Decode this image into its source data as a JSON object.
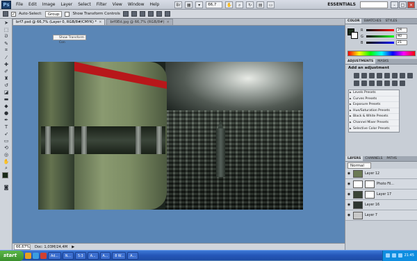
{
  "menubar": {
    "logo": "Ps",
    "items": [
      "File",
      "Edit",
      "Image",
      "Layer",
      "Select",
      "Filter",
      "View",
      "Window",
      "Help"
    ],
    "zoom": "66,7",
    "workspace": "ESSENTIALS",
    "window_buttons": [
      "-",
      "□",
      "×"
    ]
  },
  "options": {
    "auto_select_label": "Auto-Select:",
    "auto_select_value": "Group",
    "transform_label": "Show Transform Controls"
  },
  "tabs": [
    {
      "label": "brf7.psd @ 66,7% (Layer 0, RGB/8#/CMYK) *",
      "active": true
    },
    {
      "label": "brf0Ed.jpg @ 66,7% (RGB/8#)",
      "active": false
    }
  ],
  "canvas": {
    "tooltip": "Show Transform Con"
  },
  "status": {
    "zoom": "66,67%",
    "doc": "Doc: 1,03M/24,4M"
  },
  "color_panel": {
    "tabs": [
      "COLOR",
      "SWATCHES",
      "STYLES"
    ],
    "sliders": [
      {
        "letter": "R",
        "value": "24",
        "track": "#c02020"
      },
      {
        "letter": "G",
        "value": "40",
        "track": "#20a020"
      },
      {
        "letter": "B",
        "value": "21",
        "track": "#2040c0"
      }
    ]
  },
  "adjustments_panel": {
    "tabs": [
      "ADJUSTMENTS",
      "MASKS"
    ],
    "title": "Add an adjustment",
    "presets": [
      "Levels Presets",
      "Curves Presets",
      "Exposure Presets",
      "Hue/Saturation Presets",
      "Black & White Presets",
      "Channel Mixer Presets",
      "Selective Color Presets"
    ]
  },
  "layers_panel": {
    "tabs": [
      "LAYERS",
      "CHANNELS",
      "PATHS"
    ],
    "blend_mode": "Normal",
    "layers": [
      {
        "name": "Layer 12",
        "thumb": "#6b7a55",
        "mask": false,
        "selected": false
      },
      {
        "name": "Photo Fil...",
        "thumb": "#ffffff",
        "mask": true,
        "selected": false
      },
      {
        "name": "Layer 17",
        "thumb": "#3a4436",
        "mask": true,
        "selected": false
      },
      {
        "name": "Layer 16",
        "thumb": "#2d3530",
        "mask": false,
        "selected": false
      },
      {
        "name": "Layer 7",
        "thumb": "#c8c8c8",
        "mask": false,
        "selected": false
      }
    ]
  },
  "taskbar": {
    "start": "start",
    "tasks": [
      "Ad...",
      "N...",
      "5:3",
      "A...",
      "A...",
      "8 W...",
      "A..."
    ],
    "clock": "21:45"
  },
  "colors": {
    "accent_red": "#b8171a",
    "canvas_bg": "#5a86b6"
  }
}
